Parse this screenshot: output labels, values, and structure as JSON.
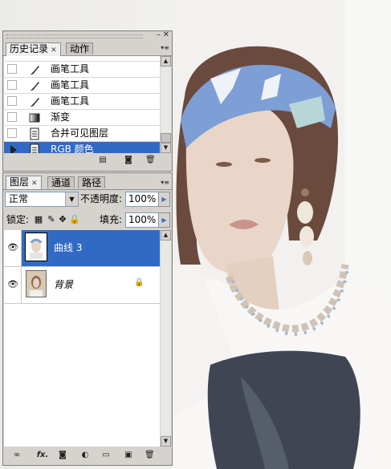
{
  "history_panel": {
    "tabs": [
      {
        "label": "历史记录",
        "active": true
      },
      {
        "label": "动作",
        "active": false
      }
    ],
    "items": [
      {
        "label": "画笔工具",
        "icon": "brush-icon",
        "selected": false
      },
      {
        "label": "画笔工具",
        "icon": "brush-icon",
        "selected": false
      },
      {
        "label": "画笔工具",
        "icon": "brush-icon",
        "selected": false
      },
      {
        "label": "渐变",
        "icon": "gradient-icon",
        "selected": false
      },
      {
        "label": "合并可见图层",
        "icon": "document-icon",
        "selected": false
      },
      {
        "label": "RGB 颜色",
        "icon": "document-icon",
        "selected": true
      }
    ],
    "bottom_icons": [
      "new-document-icon",
      "new-snapshot-icon",
      "trash-icon"
    ]
  },
  "layers_panel": {
    "tabs": [
      {
        "label": "图层",
        "active": true
      },
      {
        "label": "通道",
        "active": false
      },
      {
        "label": "路径",
        "active": false
      }
    ],
    "blend_mode": "正常",
    "opacity_label": "不透明度:",
    "opacity_value": "100%",
    "lock_label": "锁定:",
    "fill_label": "填充:",
    "fill_value": "100%",
    "layers": [
      {
        "name": "曲线 3",
        "selected": true,
        "locked": false,
        "italic": false
      },
      {
        "name": "背景",
        "selected": false,
        "locked": true,
        "italic": true
      }
    ],
    "bottom_icons": [
      "link-icon",
      "fx-icon",
      "mask-icon",
      "adjustment-icon",
      "folder-icon",
      "new-layer-icon",
      "trash-icon"
    ],
    "fx_label": "fx."
  },
  "colors": {
    "selection": "#316ac5",
    "panel_bg": "#d6d3ce",
    "headband": "#7d9fd6"
  }
}
